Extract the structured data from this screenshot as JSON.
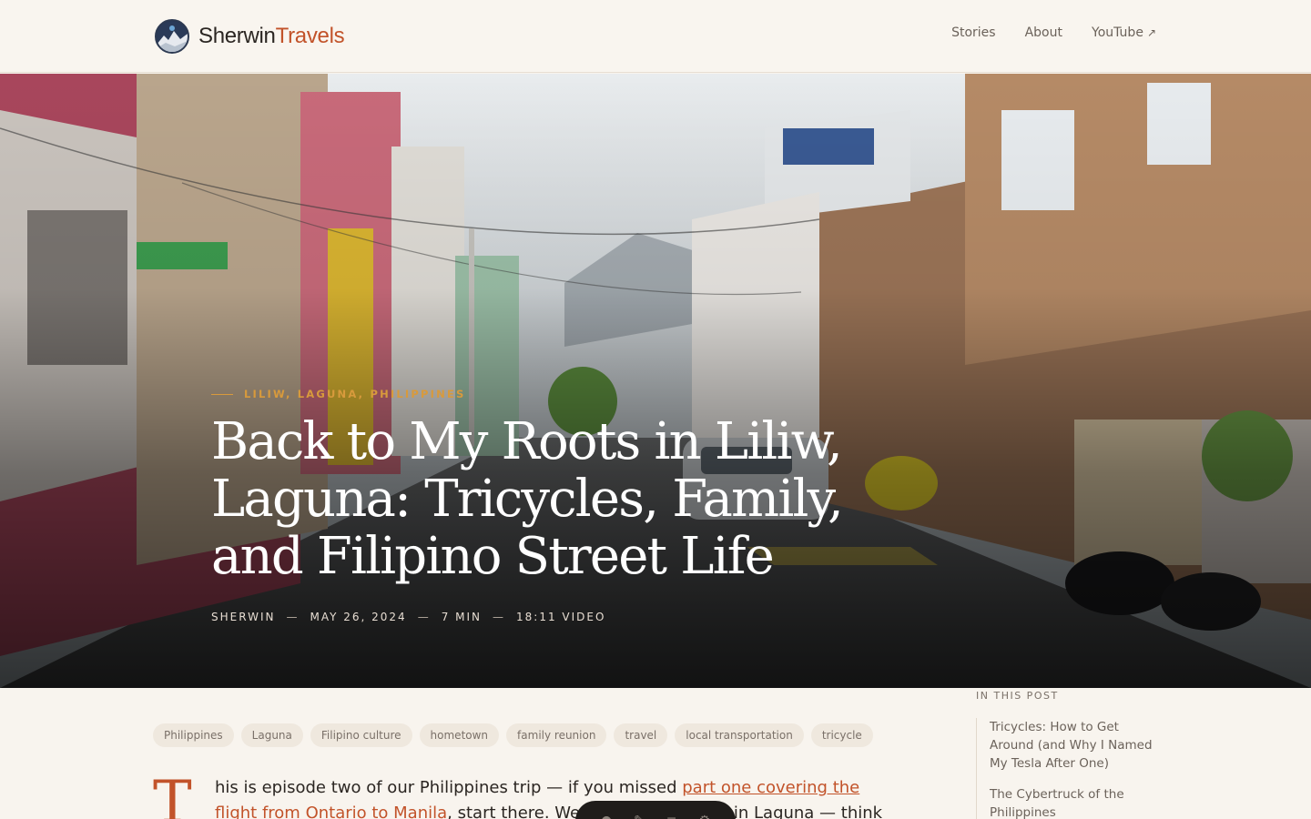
{
  "header": {
    "logo_first": "Sherwin",
    "logo_second": "Travels",
    "nav": [
      {
        "label": "Stories"
      },
      {
        "label": "About"
      },
      {
        "label": "YouTube",
        "icon": "external-link-icon"
      }
    ]
  },
  "hero": {
    "eyebrow": "Liliw, Laguna, Philippines",
    "title": "Back to My Roots in Liliw, Laguna: Tricycles, Family, and Filipino Street Life",
    "meta": [
      "Sherwin",
      "May 26, 2024",
      "7 min",
      "18:11 video"
    ]
  },
  "tags": [
    "Philippines",
    "Laguna",
    "Filipino culture",
    "hometown",
    "family reunion",
    "travel",
    "local transportation",
    "tricycle"
  ],
  "article": {
    "dropcap": "T",
    "line1_text": "his is episode two of our Philippines trip — if you missed ",
    "link_text": "part one covering the flight from Ontario to Manila",
    "line2_text": ", start there. We're in Liliw, a town in Laguna — think of a"
  },
  "toc": {
    "heading": "In this post",
    "items": [
      {
        "label": "Tricycles: How to Get Around (and Why I Named My Tesla After One)"
      },
      {
        "label": "The Cybertruck of the Philippines"
      }
    ]
  },
  "colors": {
    "accent": "#c2532a",
    "eyebrow": "#d89a3c",
    "background": "#f8f4ee"
  }
}
